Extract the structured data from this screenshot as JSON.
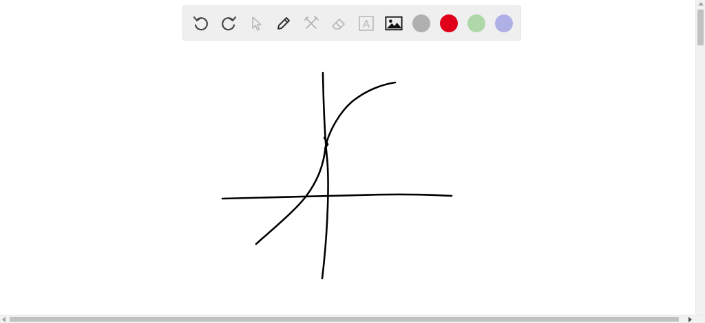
{
  "toolbar": {
    "tools": [
      {
        "name": "undo-button",
        "icon": "undo-icon"
      },
      {
        "name": "redo-button",
        "icon": "redo-icon"
      },
      {
        "name": "select-button",
        "icon": "pointer-icon"
      },
      {
        "name": "pen-button",
        "icon": "pencil-icon"
      },
      {
        "name": "tools-button",
        "icon": "tools-icon"
      },
      {
        "name": "eraser-button",
        "icon": "eraser-icon"
      },
      {
        "name": "text-button",
        "icon": "text-icon",
        "label": "A"
      },
      {
        "name": "image-button",
        "icon": "image-icon"
      }
    ],
    "colors": [
      {
        "name": "color-gray",
        "hex": "#b0b0b0"
      },
      {
        "name": "color-red",
        "hex": "#e0001a"
      },
      {
        "name": "color-green",
        "hex": "#aed8a8"
      },
      {
        "name": "color-blue",
        "hex": "#aeb0e6"
      }
    ]
  },
  "canvas": {
    "stroke_color": "#000000",
    "background": "#ffffff"
  }
}
